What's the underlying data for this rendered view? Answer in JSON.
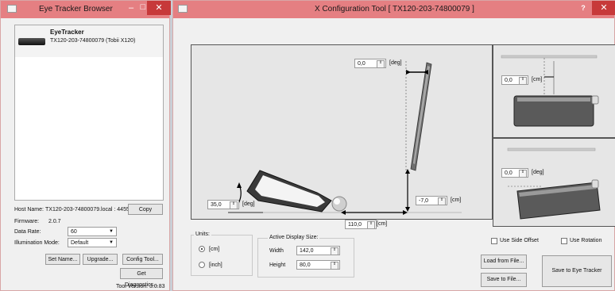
{
  "browser": {
    "title": "Eye Tracker Browser",
    "device_name": "EyeTracker",
    "device_id": "TX120-203-74800079 (Tobii X120)",
    "host_label": "Host Name:",
    "host_value": "TX120-203-74800079.local : 4455",
    "copy_label": "Copy",
    "firmware_label": "Firmware:",
    "firmware_value": "2.0.7",
    "data_rate_label": "Data Rate:",
    "data_rate_value": "60",
    "illumination_label": "Illumination Mode:",
    "illumination_value": "Default",
    "set_name_label": "Set Name...",
    "upgrade_label": "Upgrade...",
    "config_tool_label": "Config Tool...",
    "diagnostics_label": "Get Diagnostics...",
    "tool_version": "Tool Version: 3.0.83"
  },
  "config": {
    "title": "X Configuration Tool [ TX120-203-74800079 ]",
    "help_label": "?",
    "screen_angle": "0,0",
    "screen_angle_unit": "[deg]",
    "tracker_angle": "35,0",
    "tracker_angle_unit": "[deg]",
    "vertical_offset": "-7,0",
    "vertical_offset_unit": "[cm]",
    "distance": "110,0",
    "distance_unit": "[cm]",
    "side_offset": "0,0",
    "side_offset_unit": "[cm]",
    "rotation": "0,0",
    "rotation_unit": "[deg]",
    "units_label": "Units:",
    "unit_cm": "[cm]",
    "unit_inch": "[inch]",
    "display_size_label": "Active Display Size:",
    "width_label": "Width",
    "width_value": "142,0",
    "height_label": "Height",
    "height_value": "80,0",
    "use_side_offset": "Use Side Offset",
    "use_rotation": "Use Rotation",
    "load_label": "Load from File...",
    "save_file_label": "Save to File...",
    "save_tracker_label": "Save to Eye Tracker"
  },
  "colors": {
    "titlebar": "#e57f82",
    "close": "#c7393a",
    "canvas": "#e6e6e6"
  }
}
